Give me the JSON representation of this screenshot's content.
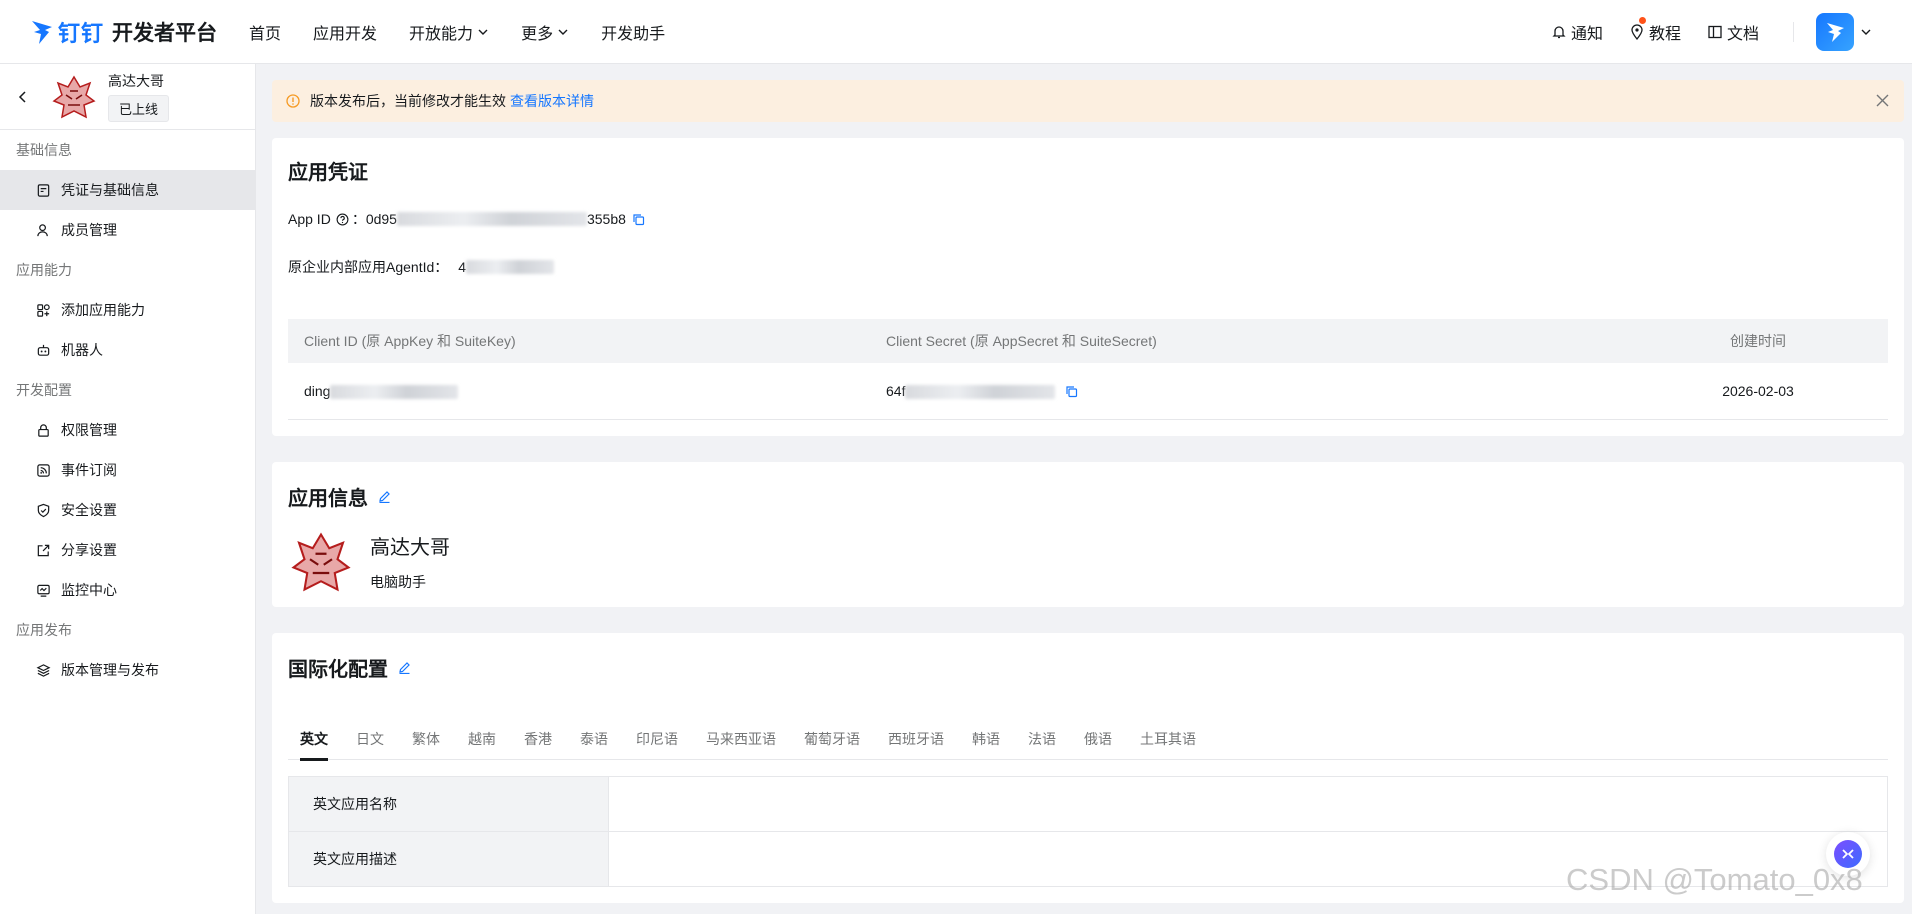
{
  "header": {
    "logo_brand": "钉钉",
    "logo_text": "开发者平台",
    "nav": [
      {
        "label": "首页",
        "has_dropdown": false
      },
      {
        "label": "应用开发",
        "has_dropdown": false
      },
      {
        "label": "开放能力",
        "has_dropdown": true
      },
      {
        "label": "更多",
        "has_dropdown": true
      },
      {
        "label": "开发助手",
        "has_dropdown": false
      }
    ],
    "tools": {
      "notify": "通知",
      "tutorial": "教程",
      "docs": "文档"
    }
  },
  "sidebar": {
    "app_name": "高达大哥",
    "app_status": "已上线",
    "groups": [
      {
        "title": "基础信息",
        "items": [
          {
            "label": "凭证与基础信息",
            "icon": "credential-icon",
            "active": true
          },
          {
            "label": "成员管理",
            "icon": "member-icon",
            "active": false
          }
        ]
      },
      {
        "title": "应用能力",
        "items": [
          {
            "label": "添加应用能力",
            "icon": "add-capability-icon",
            "active": false
          },
          {
            "label": "机器人",
            "icon": "robot-icon",
            "active": false
          }
        ]
      },
      {
        "title": "开发配置",
        "items": [
          {
            "label": "权限管理",
            "icon": "lock-icon",
            "active": false
          },
          {
            "label": "事件订阅",
            "icon": "rss-icon",
            "active": false
          },
          {
            "label": "安全设置",
            "icon": "shield-icon",
            "active": false
          },
          {
            "label": "分享设置",
            "icon": "share-icon",
            "active": false
          },
          {
            "label": "监控中心",
            "icon": "monitor-icon",
            "active": false
          }
        ]
      },
      {
        "title": "应用发布",
        "items": [
          {
            "label": "版本管理与发布",
            "icon": "layers-icon",
            "active": false
          }
        ]
      }
    ]
  },
  "alert": {
    "text": "版本发布后，当前修改才能生效",
    "link": "查看版本详情"
  },
  "credentials": {
    "title": "应用凭证",
    "app_id_label": "App ID",
    "app_id_prefix": "0d95",
    "app_id_suffix": "355b8",
    "agent_label": "原企业内部应用AgentId：",
    "agent_prefix": "4",
    "table_headers": [
      "Client ID (原 AppKey 和 SuiteKey)",
      "Client Secret (原 AppSecret 和 SuiteSecret)",
      "创建时间"
    ],
    "client_id_prefix": "ding",
    "client_secret_prefix": "64f",
    "created": "2026-02-03"
  },
  "app_info": {
    "title": "应用信息",
    "name": "高达大哥",
    "desc": "电脑助手"
  },
  "i18n": {
    "title": "国际化配置",
    "tabs": [
      "英文",
      "日文",
      "繁体",
      "越南",
      "香港",
      "泰语",
      "印尼语",
      "马来西亚语",
      "葡萄牙语",
      "西班牙语",
      "韩语",
      "法语",
      "俄语",
      "土耳其语"
    ],
    "active_tab": "英文",
    "rows": [
      {
        "label": "英文应用名称",
        "value": ""
      },
      {
        "label": "英文应用描述",
        "value": ""
      }
    ]
  },
  "watermark": "CSDN @Tomato_0x8",
  "colors": {
    "accent": "#1677ff",
    "alert_bg": "#fcefe0",
    "alert_icon": "#f59a23"
  }
}
